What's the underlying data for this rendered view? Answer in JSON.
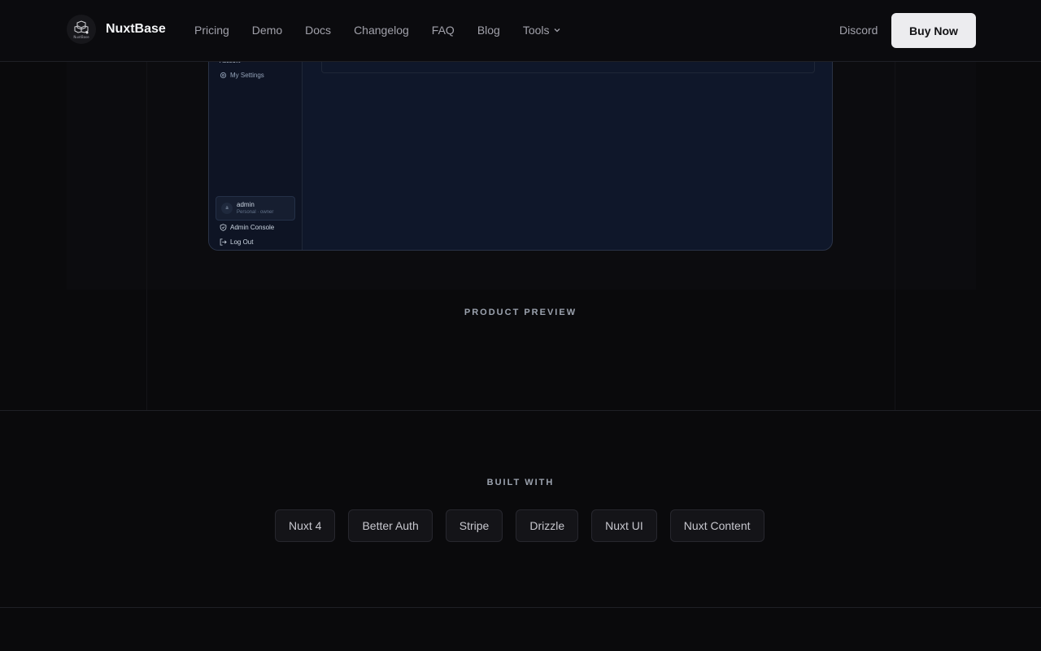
{
  "header": {
    "brand": "NuxtBase",
    "logo_caption": "NuxtBase",
    "nav": [
      "Pricing",
      "Demo",
      "Docs",
      "Changelog",
      "FAQ",
      "Blog",
      "Tools"
    ],
    "discord": "Discord",
    "buy_label": "Buy Now"
  },
  "preview": {
    "section_heading": "Account",
    "settings_link": "My Settings",
    "user_name": "admin",
    "user_avatar": "a",
    "user_role": "Personal · owner",
    "admin_console": "Admin Console",
    "logout": "Log Out"
  },
  "product_preview_label": "PRODUCT PREVIEW",
  "built_with": {
    "label": "BUILT WITH",
    "items": [
      "Nuxt 4",
      "Better Auth",
      "Stripe",
      "Drizzle",
      "Nuxt UI",
      "Nuxt Content"
    ]
  },
  "colors": {
    "background": "#0a0a0c",
    "buy_button": "#ececef",
    "preview_bg": "#0f172a"
  }
}
